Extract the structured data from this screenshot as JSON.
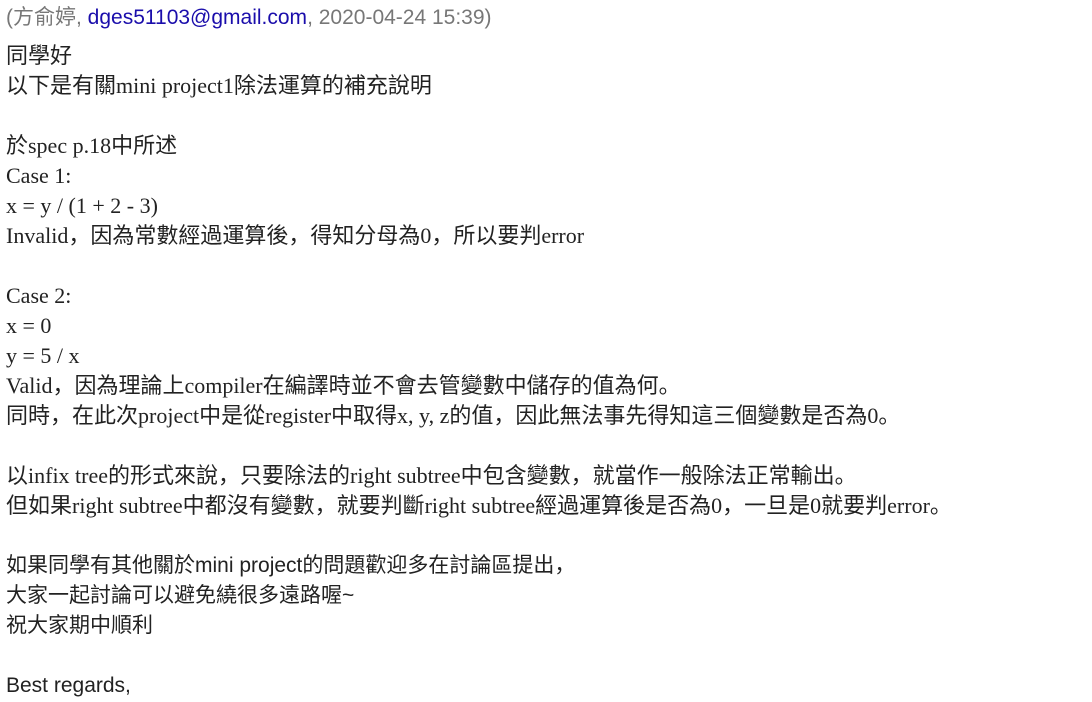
{
  "header": {
    "open_paren": "(",
    "sender_name": "方俞婷",
    "sep1": ", ",
    "sender_email": "dges51103@gmail.com",
    "sep2": ", ",
    "datetime": "2020-04-24 15:39",
    "close_paren": ")"
  },
  "body": {
    "l01": "同學好",
    "l02": "以下是有關mini project1除法運算的補充說明",
    "l03": "於spec p.18中所述",
    "l04": "Case 1:",
    "l05": "x = y / (1 + 2 - 3)",
    "l06": "Invalid，因為常數經過運算後，得知分母為0，所以要判error",
    "l07": "Case 2:",
    "l08": "x = 0",
    "l09": "y = 5 / x",
    "l10": "Valid，因為理論上compiler在編譯時並不會去管變數中儲存的值為何。",
    "l11": "同時，在此次project中是從register中取得x, y, z的值，因此無法事先得知這三個變數是否為0。",
    "l12": "以infix tree的形式來說，只要除法的right subtree中包含變數，就當作一般除法正常輸出。",
    "l13": "但如果right subtree中都沒有變數，就要判斷right subtree經過運算後是否為0，一旦是0就要判error。",
    "l14": "如果同學有其他關於mini project的問題歡迎多在討論區提出，",
    "l15": "大家一起討論可以避免繞很多遠路喔~",
    "l16": "祝大家期中順利",
    "l17": "Best regards,"
  },
  "colors": {
    "text": "#222222",
    "meta": "#777777",
    "link": "#1a0dab"
  }
}
